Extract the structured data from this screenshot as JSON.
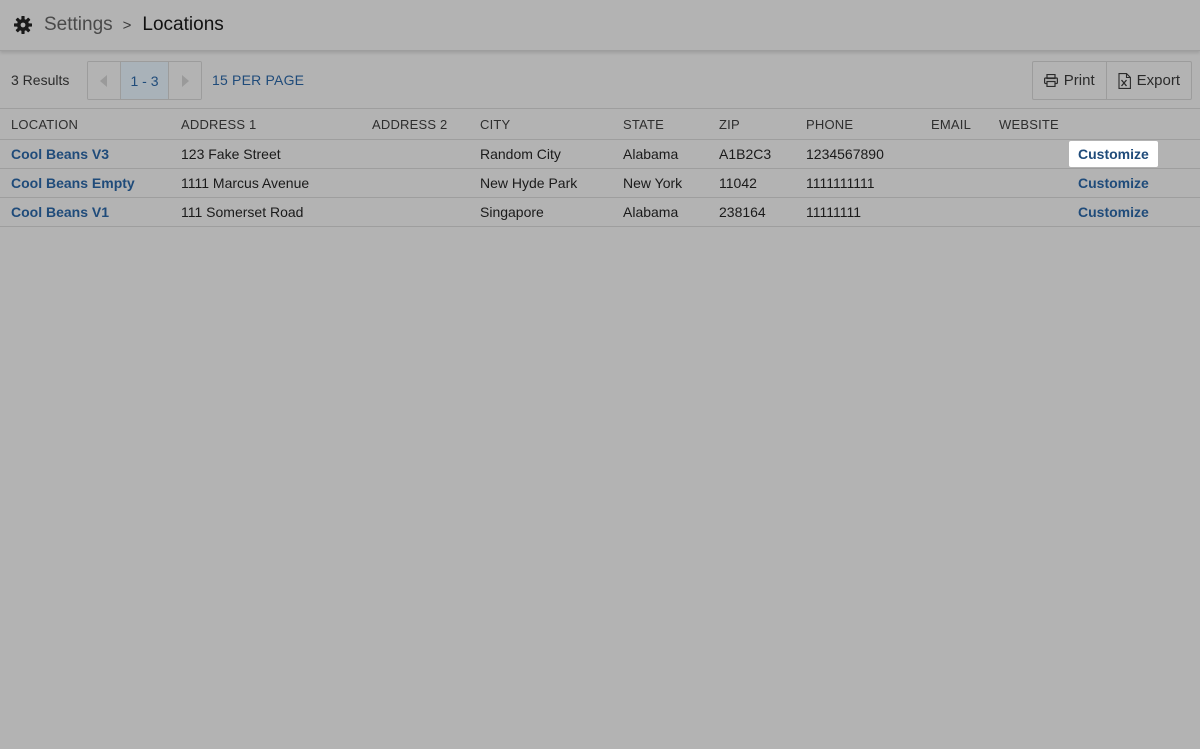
{
  "header": {
    "breadcrumb_root": "Settings",
    "breadcrumb_separator": ">",
    "breadcrumb_current": "Locations",
    "icon": "gear-icon"
  },
  "toolbar": {
    "results_text": "3 Results",
    "pager_range": "1 - 3",
    "per_page": "15 PER PAGE",
    "print_label": "Print",
    "export_label": "Export"
  },
  "table": {
    "columns": [
      "LOCATION",
      "ADDRESS 1",
      "ADDRESS 2",
      "CITY",
      "STATE",
      "ZIP",
      "PHONE",
      "EMAIL",
      "WEBSITE",
      ""
    ],
    "rows": [
      {
        "location": "Cool Beans V3",
        "address1": "123 Fake Street",
        "address2": "",
        "city": "Random City",
        "state": "Alabama",
        "zip": "A1B2C3",
        "phone": "1234567890",
        "email": "",
        "website": "",
        "action": "Customize"
      },
      {
        "location": "Cool Beans Empty",
        "address1": "1111 Marcus Avenue",
        "address2": "",
        "city": "New Hyde Park",
        "state": "New York",
        "zip": "11042",
        "phone": "1111111111",
        "email": "",
        "website": "",
        "action": "Customize"
      },
      {
        "location": "Cool Beans V1",
        "address1": "111 Somerset Road",
        "address2": "",
        "city": "Singapore",
        "state": "Alabama",
        "zip": "238164",
        "phone": "11111111",
        "email": "",
        "website": "",
        "action": "Customize"
      }
    ]
  },
  "colors": {
    "overlay_background": "#b3b3b3",
    "link": "#1f4b7a",
    "highlight": "#ffffff"
  }
}
